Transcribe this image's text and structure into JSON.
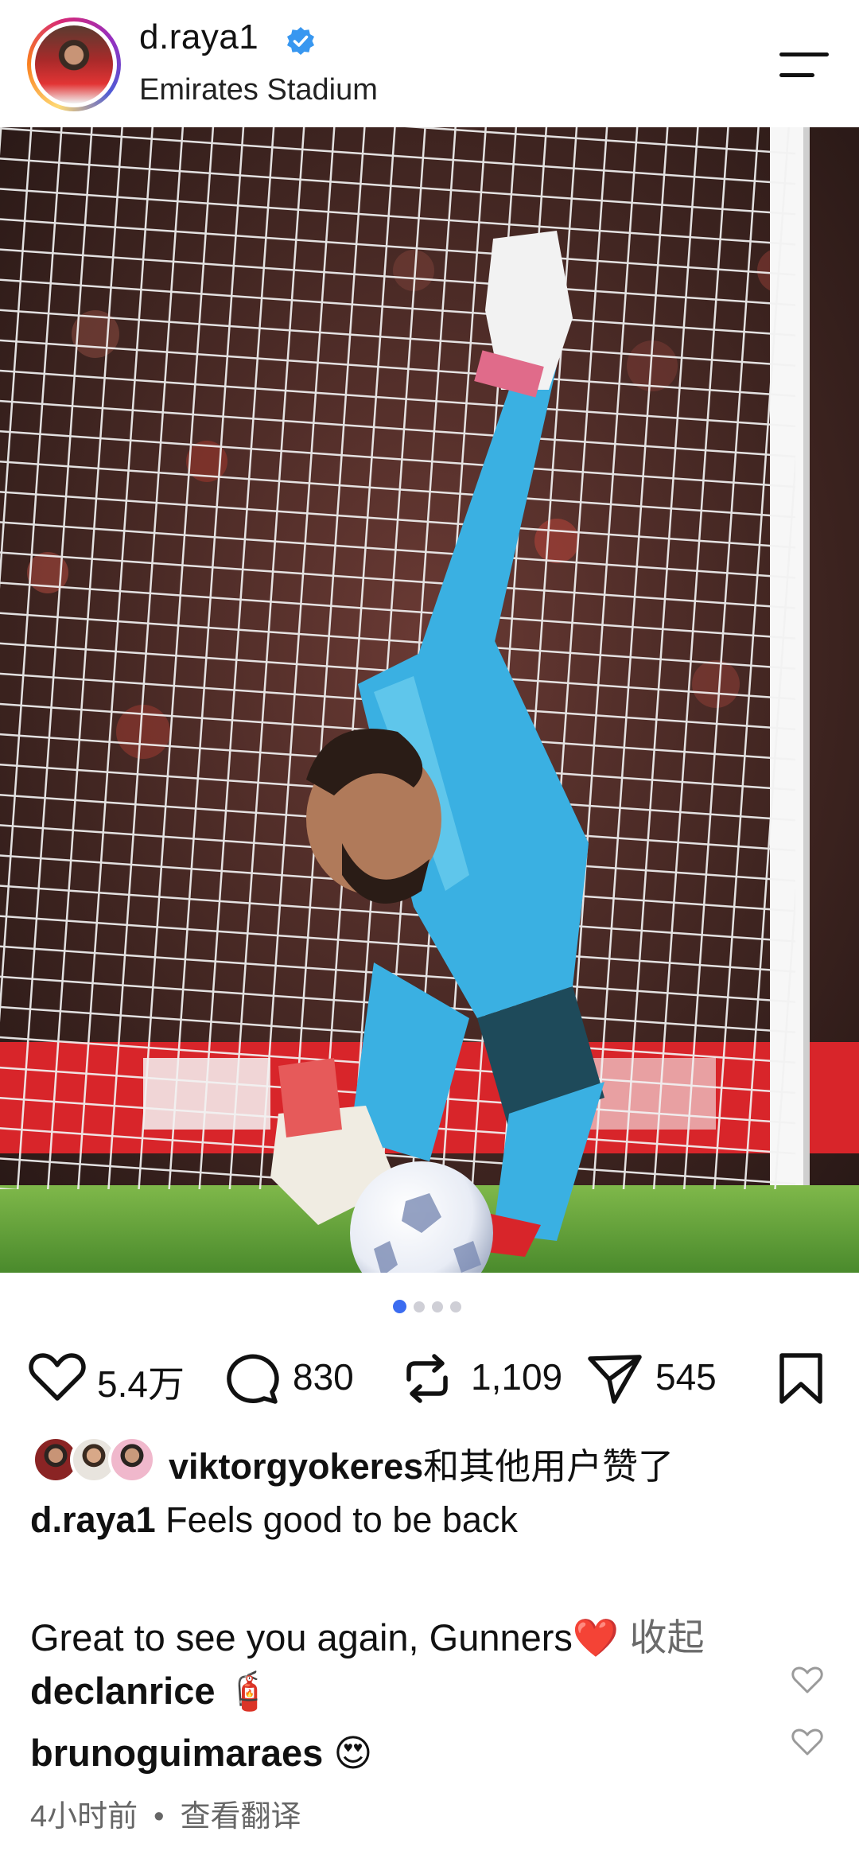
{
  "header": {
    "username": "d.raya1",
    "location": "Emirates Stadium"
  },
  "carousel": {
    "total": 4,
    "active": 1
  },
  "actions": {
    "likes": "5.4万",
    "comments": "830",
    "reposts": "1,109",
    "shares": "545"
  },
  "likes_line": {
    "user": "viktorgyokeres",
    "text": "和其他用户赞了"
  },
  "caption": {
    "user": "d.raya1",
    "line1": "Feels good to be back",
    "line2": "Great to see you again, Gunners❤️",
    "collapse_label": "收起"
  },
  "comments": [
    {
      "user": "declanrice",
      "text": "🧯"
    },
    {
      "user": "brunoguimaraes",
      "text": "😍"
    }
  ],
  "meta": {
    "time": "4小时前",
    "translate_label": "查看翻译"
  },
  "colors": {
    "verified": "#3897f0",
    "active_dot": "#3b6cf0",
    "kit": "#3ab0e2",
    "heart": "#e0245e"
  },
  "icons": [
    "verified-badge-icon",
    "menu-icon",
    "heart-icon",
    "comment-icon",
    "repost-icon",
    "share-icon",
    "bookmark-icon"
  ]
}
